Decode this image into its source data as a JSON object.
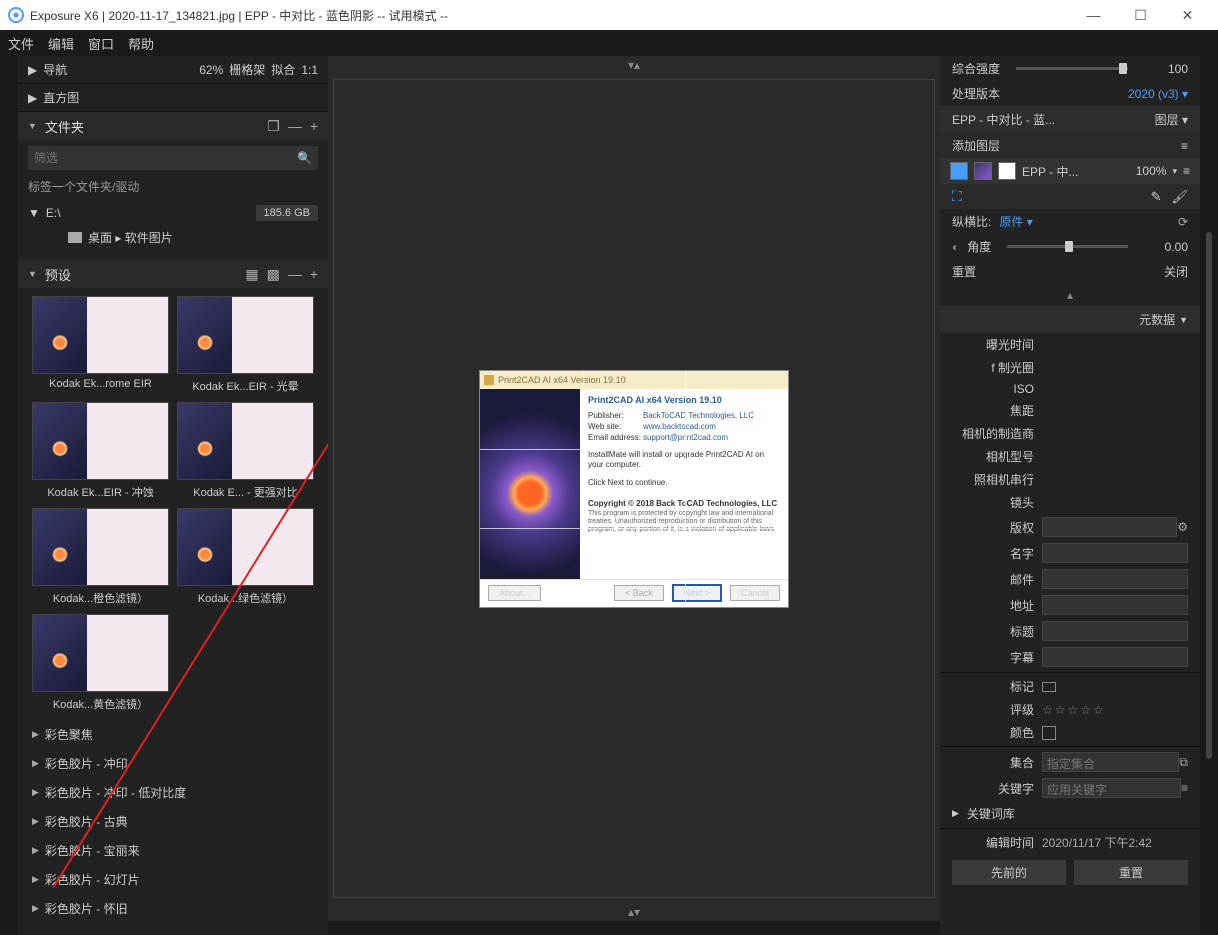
{
  "titlebar": {
    "title": "Exposure X6 | 2020-11-17_134821.jpg | EPP - 中对比 - 蓝色阴影 -- 试用模式 --"
  },
  "menu": [
    "文件",
    "编辑",
    "窗口",
    "帮助"
  ],
  "left": {
    "nav": {
      "label": "导航",
      "zoom": "62%",
      "grid": "栅格架",
      "fit": "拟合",
      "ratio": "1:1"
    },
    "histogram": "直方图",
    "folders": {
      "title": "文件夹",
      "filter_placeholder": "筛选",
      "tag_hint": "标签一个文件夹/驱动",
      "drive": "E:\\",
      "drive_size": "185.6 GB",
      "path": "桌面 ▸ 软件图片"
    },
    "presets": {
      "title": "预设",
      "items": [
        "Kodak Ek...rome EIR",
        "Kodak Ek...EIR - 光晕",
        "Kodak Ek...EIR - 冲蚀",
        "Kodak E... - 更强对比",
        "Kodak...橙色滤镜）",
        "Kodak...绿色滤镜）",
        "Kodak...黄色滤镜）"
      ],
      "categories": [
        "彩色聚焦",
        "彩色胶片 - 冲印",
        "彩色胶片 - 冲印 - 低对比度",
        "彩色胶片 - 古典",
        "彩色胶片 - 宝丽来",
        "彩色胶片 - 幻灯片",
        "彩色胶片 - 怀旧"
      ]
    }
  },
  "dialog": {
    "title": "Print2CAD AI x64 Version 19.10",
    "header": "Print2CAD AI x64 Version 19.10",
    "publisher_k": "Publisher:",
    "publisher_v": "BackToCAD Technologies, LLC",
    "website_k": "Web site:",
    "website_v": "www.backtocad.com",
    "email_k": "Email address:",
    "email_v": "support@print2cad.com",
    "install_text": "InstallMate will install or upgrade Print2CAD AI on your computer.",
    "next_text": "Click Next to continue.",
    "copyright": "Copyright © 2018 Back ToCAD Technologies, LLC",
    "fine": "This program is protected by copyright law and international treaties. Unauthorized reproduction or distribution of this program, or any portion of it, is a violation of applicable laws.",
    "btn_about": "About...",
    "btn_back": "< Back",
    "btn_next": "Next >",
    "btn_cancel": "Cancel"
  },
  "right": {
    "intensity": {
      "label": "综合强度",
      "value": "100"
    },
    "version": {
      "label": "处理版本",
      "value": "2020 (v3)"
    },
    "preset_name": "EPP - 中对比 - 蓝...",
    "layers_label": "图层",
    "add_layer": "添加图层",
    "layer_name": "EPP - 中...",
    "layer_opacity": "100%",
    "aspect": {
      "label": "纵横比:",
      "value": "原件"
    },
    "angle": {
      "label": "角度",
      "value": "0.00"
    },
    "reset": "重置",
    "close": "关闭",
    "metadata_title": "元数据",
    "meta_fields": {
      "exposure": "曝光时间",
      "aperture": "f 制光圈",
      "iso": "ISO",
      "focal": "焦距",
      "maker": "相机的制造商",
      "model": "相机型号",
      "serial": "照相机串行",
      "lens": "镜头",
      "copyright": "版权",
      "name": "名字",
      "email": "邮件",
      "address": "地址",
      "title": "标题",
      "subtitle": "字幕",
      "tag": "标记",
      "rating": "评级",
      "color": "颜色",
      "collection": "集合",
      "collection_hint": "指定集合",
      "keywords": "关键字",
      "keywords_hint": "应用关键字",
      "keyword_lib": "关键词库",
      "edit_time_k": "编辑时间",
      "edit_time_v": "2020/11/17 下午2:42",
      "previous": "先前的",
      "reset": "重置"
    }
  }
}
